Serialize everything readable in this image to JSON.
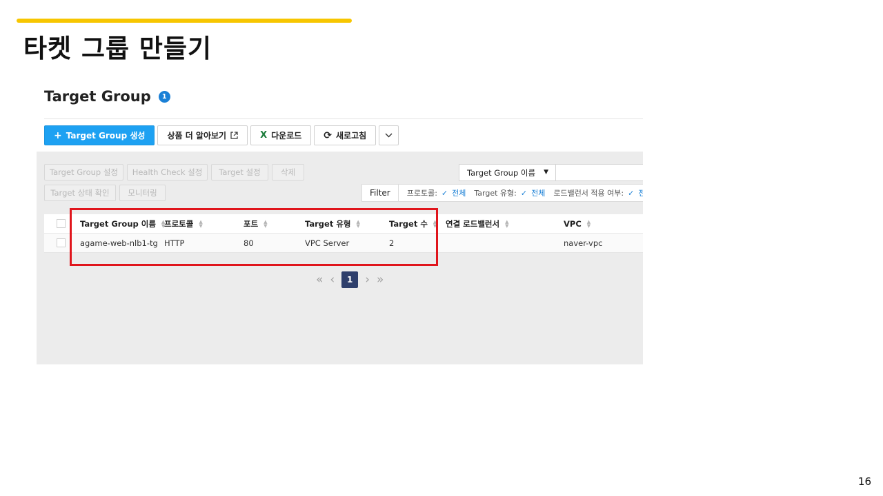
{
  "slide": {
    "title": "타켓 그룹 만들기",
    "page_number": "16",
    "accent_color": "#f7c600",
    "highlight_color": "#e0151c"
  },
  "console": {
    "title": "Target Group",
    "count_badge": "1",
    "toolbar": {
      "create_label": "Target Group 생성",
      "learn_more_label": "상품 더 알아보기",
      "download_label": "다운로드",
      "refresh_label": "새로고침"
    },
    "actions": {
      "settings": "Target Group 설정",
      "health_check": "Health Check 설정",
      "target_settings": "Target 설정",
      "delete": "삭제",
      "target_status": "Target 상태 확인",
      "monitoring": "모니터링"
    },
    "search": {
      "field_selected": "Target Group 이름",
      "query": ""
    },
    "filter": {
      "label": "Filter",
      "items": [
        {
          "name": "프로토콜:",
          "value": "전체"
        },
        {
          "name": "Target 유형:",
          "value": "전체"
        },
        {
          "name": "로드밸런서 적용 여부:",
          "value": "전체"
        }
      ]
    },
    "table": {
      "columns": [
        "Target Group 이름",
        "프로토콜",
        "포트",
        "Target 유형",
        "Target 수",
        "연결 로드밸런서",
        "VPC"
      ],
      "rows": [
        {
          "name": "agame-web-nlb1-tg",
          "protocol": "HTTP",
          "port": "80",
          "target_type": "VPC Server",
          "target_count": "2",
          "load_balancer": "",
          "vpc": "naver-vpc"
        }
      ]
    },
    "pagination": {
      "current_page": "1"
    }
  }
}
